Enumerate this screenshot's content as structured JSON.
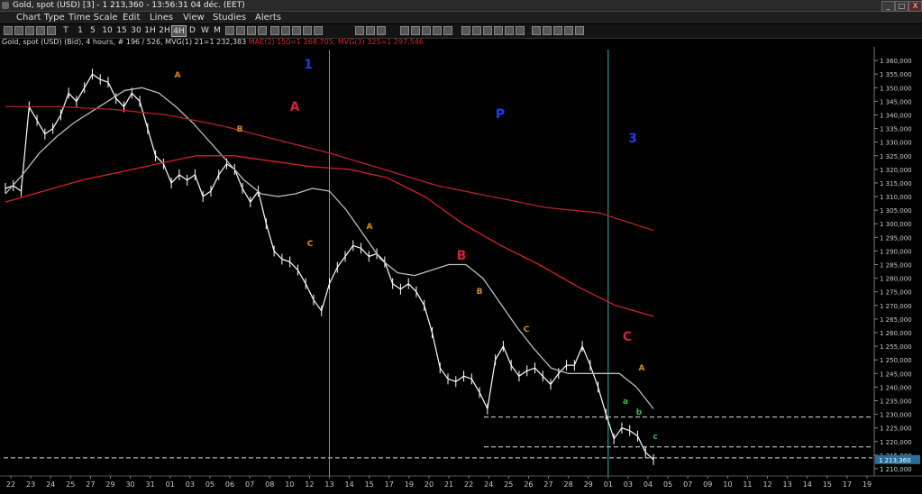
{
  "window": {
    "title": "Gold, spot (USD) [3] - 1 213,360 - 13:56:31  04 déc. (EET)",
    "controls": [
      "_",
      "□",
      "X"
    ]
  },
  "menu": [
    "Chart Type",
    "Time Scale",
    "Edit",
    "Lines",
    "View",
    "Studies",
    "Alerts"
  ],
  "toolbar": {
    "timeframes": [
      "T",
      "1",
      "5",
      "10",
      "15",
      "30",
      "1H",
      "2H",
      "4H",
      "D",
      "W",
      "M"
    ],
    "selected": "4H"
  },
  "info": {
    "main": "Gold, spot (USD) (Bid), 4 hours, # 196 / 526, MVG(1) 21=1 232,383",
    "ma1": "MAE(2) 150=1 268,705, MVG(3) 325=1 297,546"
  },
  "chart_data": {
    "type": "line",
    "ylim": [
      1208000,
      1364000
    ],
    "price_ticks": [
      1360000,
      1355000,
      1350000,
      1345000,
      1340000,
      1335000,
      1330000,
      1325000,
      1320000,
      1315000,
      1310000,
      1305000,
      1300000,
      1295000,
      1290000,
      1285000,
      1280000,
      1275000,
      1270000,
      1265000,
      1260000,
      1255000,
      1250000,
      1245000,
      1240000,
      1235000,
      1230000,
      1225000,
      1220000,
      1215000,
      1210000
    ],
    "price_tick_labels": [
      "1 360,000",
      "1 355,000",
      "1 350,000",
      "1 345,000",
      "1 340,000",
      "1 335,000",
      "1 330,000",
      "1 325,000",
      "1 320,000",
      "1 315,000",
      "1 310,000",
      "1 305,000",
      "1 300,000",
      "1 295,000",
      "1 290,000",
      "1 285,000",
      "1 280,000",
      "1 275,000",
      "1 270,000",
      "1 265,000",
      "1 260,000",
      "1 255,000",
      "1 250,000",
      "1 245,000",
      "1 240,000",
      "1 235,000",
      "1 230,000",
      "1 225,000",
      "1 220,000",
      "1 215,000",
      "1 210,000"
    ],
    "last_price_label": "1 213,360",
    "last_price": 1213360,
    "date_labels": [
      "22",
      "23",
      "24",
      "25",
      "27",
      "29",
      "30",
      "31",
      "01",
      "03",
      "05",
      "06",
      "07",
      "08",
      "10",
      "12",
      "13",
      "14",
      "15",
      "17",
      "19",
      "20",
      "21",
      "22",
      "24",
      "25",
      "26",
      "27",
      "28",
      "29",
      "01",
      "03",
      "04",
      "05",
      "07",
      "09",
      "10",
      "11",
      "12",
      "13",
      "14",
      "15",
      "17",
      "19"
    ],
    "date_slots": [
      0,
      1,
      2,
      3,
      4,
      5,
      6,
      7,
      8,
      9,
      10,
      11,
      12,
      13,
      14,
      15,
      16,
      17,
      18,
      19,
      20,
      21,
      22,
      23,
      24,
      25,
      26,
      27,
      28,
      29,
      30,
      31,
      32,
      33,
      34,
      35,
      36,
      37,
      38,
      39,
      40,
      41,
      42,
      43
    ],
    "vlines_slots": [
      16,
      30
    ],
    "series": [
      {
        "name": "Gold, spot (USD)",
        "color": "#ffffff",
        "values": [
          1313000,
          1314000,
          1312000,
          1343000,
          1338000,
          1333000,
          1335000,
          1340000,
          1348000,
          1345000,
          1350000,
          1355000,
          1353000,
          1352000,
          1346000,
          1343000,
          1348000,
          1345000,
          1335000,
          1325000,
          1322000,
          1315000,
          1318000,
          1316000,
          1318000,
          1310000,
          1312000,
          1318000,
          1322000,
          1320000,
          1313000,
          1308000,
          1312000,
          1300000,
          1290000,
          1287000,
          1286000,
          1283000,
          1278000,
          1272000,
          1268000,
          1278000,
          1284000,
          1288000,
          1292000,
          1291000,
          1288000,
          1289000,
          1286000,
          1278000,
          1276000,
          1278000,
          1275000,
          1270000,
          1260000,
          1247000,
          1243000,
          1242000,
          1244000,
          1243000,
          1238000,
          1232000,
          1250000,
          1255000,
          1248000,
          1244000,
          1246000,
          1247000,
          1244000,
          1241000,
          1245000,
          1248000,
          1248000,
          1255000,
          1248000,
          1240000,
          1230000,
          1221000,
          1225000,
          1224000,
          1222000,
          1216000,
          1213360
        ]
      },
      {
        "name": "MVG(1) 21",
        "color": "#bdbdbd",
        "values": [
          1311000,
          1318000,
          1326000,
          1332000,
          1337000,
          1341000,
          1345000,
          1349000,
          1350000,
          1348000,
          1343000,
          1337000,
          1330000,
          1323000,
          1316000,
          1311000,
          1310000,
          1311000,
          1313000,
          1312000,
          1305000,
          1296000,
          1287000,
          1282000,
          1281000,
          1283000,
          1285000,
          1285000,
          1280000,
          1271000,
          1262000,
          1254000,
          1247000,
          1245000,
          1245000,
          1245000,
          1245000,
          1240000,
          1232000
        ]
      },
      {
        "name": "MAE(2) 150",
        "color": "#d4232a",
        "values": [
          1308000,
          1312000,
          1316000,
          1319000,
          1322000,
          1325000,
          1325000,
          1323000,
          1321000,
          1320000,
          1317000,
          1310000,
          1300000,
          1292000,
          1285000,
          1277000,
          1270000,
          1266000
        ]
      },
      {
        "name": "MVG(3) 325",
        "color": "#b8232a",
        "values": [
          1343000,
          1343000,
          1342000,
          1340000,
          1336000,
          1331000,
          1326000,
          1320000,
          1314000,
          1310000,
          1306000,
          1304000,
          1297546
        ]
      }
    ],
    "reference_levels": [
      1229000,
      1218000,
      1214000
    ],
    "annotations": [
      {
        "text": "1",
        "color": "#1f3ee6"
      },
      {
        "text": "P",
        "color": "#1f3ee6"
      },
      {
        "text": "3",
        "color": "#1f3ee6"
      },
      {
        "text": "A",
        "color": "#d2203a"
      },
      {
        "text": "B",
        "color": "#d2203a"
      },
      {
        "text": "C",
        "color": "#d2203a"
      },
      {
        "text": "A",
        "color": "#e08a1c"
      },
      {
        "text": "B",
        "color": "#e08a1c"
      },
      {
        "text": "C",
        "color": "#e08a1c"
      },
      {
        "text": "A",
        "color": "#e08a1c"
      },
      {
        "text": "B",
        "color": "#e08a1c"
      },
      {
        "text": "C",
        "color": "#e08a1c"
      },
      {
        "text": "A",
        "color": "#e08a1c"
      },
      {
        "text": "a",
        "color": "#2fc03a"
      },
      {
        "text": "b",
        "color": "#2fc03a"
      },
      {
        "text": "c",
        "color": "#2fc03a"
      }
    ]
  }
}
